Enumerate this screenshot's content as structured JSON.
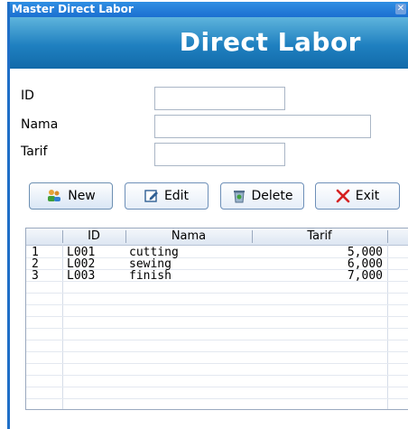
{
  "window": {
    "title": "Master Direct Labor"
  },
  "banner": {
    "heading": "Direct Labor"
  },
  "form": {
    "id_label": "ID",
    "nama_label": "Nama",
    "tarif_label": "Tarif",
    "id_value": "",
    "nama_value": "",
    "tarif_value": ""
  },
  "toolbar": {
    "new_label": "New",
    "edit_label": "Edit",
    "delete_label": "Delete",
    "exit_label": "Exit"
  },
  "grid": {
    "headers": [
      "ID",
      "Nama",
      "Tarif"
    ],
    "rows": [
      {
        "no": "1",
        "id": "L001",
        "nama": "cutting",
        "tarif": "5,000"
      },
      {
        "no": "2",
        "id": "L002",
        "nama": "sewing",
        "tarif": "6,000"
      },
      {
        "no": "3",
        "id": "L003",
        "nama": "finish",
        "tarif": "7,000"
      }
    ]
  },
  "colors": {
    "title_bar": "#1b6fd0",
    "banner": "#1f80c0",
    "exit_icon": "#d62020"
  },
  "icons": [
    "close-icon",
    "users-icon",
    "edit-icon",
    "delete-icon",
    "exit-icon"
  ]
}
